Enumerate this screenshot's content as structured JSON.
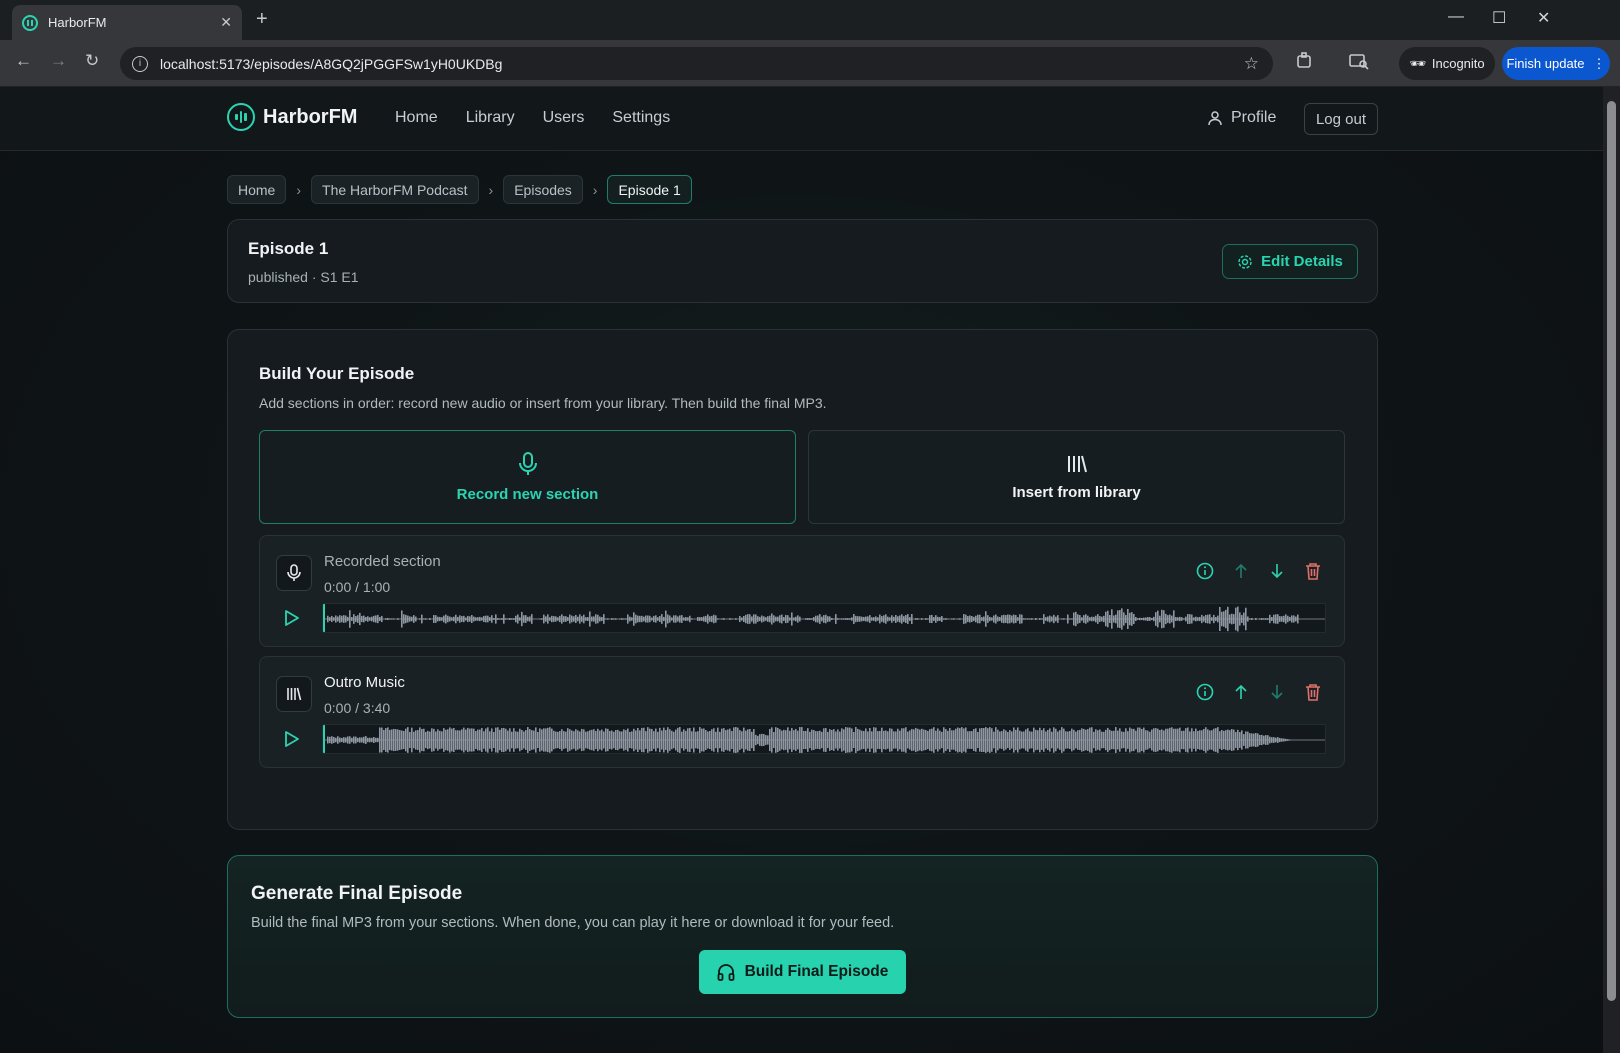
{
  "browser": {
    "tab_title": "HarborFM",
    "url": "localhost:5173/episodes/A8GQ2jPGGFSw1yH0UKDBg",
    "incognito_label": "Incognito",
    "update_label": "Finish update"
  },
  "nav": {
    "brand": "HarborFM",
    "links": [
      "Home",
      "Library",
      "Users",
      "Settings"
    ],
    "profile": "Profile",
    "logout": "Log out"
  },
  "breadcrumb": [
    "Home",
    "The HarborFM Podcast",
    "Episodes",
    "Episode 1"
  ],
  "episode": {
    "title": "Episode 1",
    "subtitle": "published · S1 E1",
    "edit_label": "Edit Details"
  },
  "builder": {
    "title": "Build Your Episode",
    "subtitle": "Add sections in order: record new audio or insert from your library. Then build the final MP3.",
    "record_label": "Record new section",
    "library_label": "Insert from library",
    "sections": [
      {
        "name": "Recorded section",
        "time": "0:00 / 1:00",
        "icon": "mic-icon",
        "name_color": "#a8b1b8"
      },
      {
        "name": "Outro Music",
        "time": "0:00 / 3:40",
        "icon": "library-icon",
        "name_color": "#f1f3f4"
      }
    ]
  },
  "generate": {
    "title": "Generate Final Episode",
    "subtitle": "Build the final MP3 from your sections. When done, you can play it here or download it for your feed.",
    "button": "Build Final Episode"
  },
  "colors": {
    "accent": "#2bd4b0",
    "danger": "#e0706a",
    "wave": "#8f97a3"
  }
}
